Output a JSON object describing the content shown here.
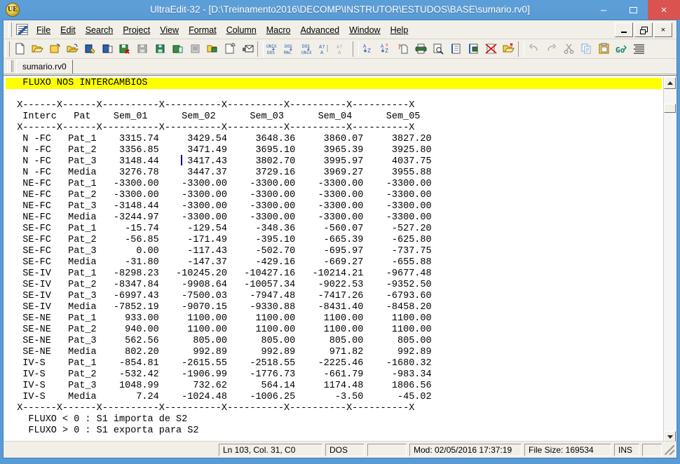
{
  "window": {
    "title": "UltraEdit-32 - [D:\\Treinamento2016\\DECOMP\\INSTRUTOR\\ESTUDOS\\BASE\\sumario.rv0]",
    "app_icon_text": "UE",
    "minimize_label": "–",
    "maximize_label": "",
    "close_label": "×"
  },
  "menu": {
    "items": [
      {
        "label": "File"
      },
      {
        "label": "Edit"
      },
      {
        "label": "Search"
      },
      {
        "label": "Project"
      },
      {
        "label": "View"
      },
      {
        "label": "Format"
      },
      {
        "label": "Column"
      },
      {
        "label": "Macro"
      },
      {
        "label": "Advanced"
      },
      {
        "label": "Window"
      },
      {
        "label": "Help"
      }
    ],
    "mdi_minimize": "_",
    "mdi_restore": "",
    "mdi_close": "×"
  },
  "toolbar": {
    "icons": [
      "new-file-icon",
      "open-file-icon",
      "close-file-icon",
      "open-all-icon",
      "save-as-icon",
      "save-icon",
      "save-close-icon",
      "save-all-icon",
      "make-copy-icon",
      "save-copy-icon",
      "revert-icon",
      "open-ftp-icon",
      "new-from-template-icon",
      "email-icon",
      "unix-to-dos-icon",
      "dos-to-mac-icon",
      "dos-to-unix-icon",
      "ascii-to-ansi-icon",
      "ansi-to-ascii-icon",
      "sort-ascending-icon",
      "sort-descending-icon",
      "spell-check-icon",
      "print-icon",
      "print-preview-icon",
      "page-setup-icon",
      "print-setup-icon",
      "delete-file-icon",
      "open-project-icon",
      "undo-icon",
      "redo-icon",
      "cut-icon",
      "copy-icon",
      "paste-icon",
      "goto-icon",
      "reindent-icon"
    ]
  },
  "tabs": {
    "items": [
      {
        "label": "sumario.rv0",
        "active": true
      }
    ]
  },
  "editor": {
    "highlight_line": "   FLUXO NOS INTERCAMBIOS",
    "highlight_color": "#ffff00",
    "caret_column": 31,
    "lines": [
      "  X------X------X----------X----------X----------X----------X----------X",
      "   Interc   Pat    Sem_01      Sem_02      Sem_03      Sem_04      Sem_05",
      "  X------X------X----------X----------X----------X----------X----------X",
      "   N -FC   Pat_1    3315.74     3429.54     3648.36     3860.07     3827.20",
      "   N -FC   Pat_2    3356.85     3471.49     3695.10     3965.39     3925.80",
      "   N -FC   Pat_3    3148.44     3417.43     3802.70     3995.97     4037.75",
      "   N -FC   Media    3276.78     3447.37     3729.16     3969.27     3955.88",
      "   NE-FC   Pat_1   -3300.00    -3300.00    -3300.00    -3300.00    -3300.00",
      "   NE-FC   Pat_2   -3300.00    -3300.00    -3300.00    -3300.00    -3300.00",
      "   NE-FC   Pat_3   -3148.44    -3300.00    -3300.00    -3300.00    -3300.00",
      "   NE-FC   Media   -3244.97    -3300.00    -3300.00    -3300.00    -3300.00",
      "   SE-FC   Pat_1     -15.74     -129.54     -348.36     -560.07     -527.20",
      "   SE-FC   Pat_2     -56.85     -171.49     -395.10     -665.39     -625.80",
      "   SE-FC   Pat_3       0.00     -117.43     -502.70     -695.97     -737.75",
      "   SE-FC   Media     -31.80     -147.37     -429.16     -669.27     -655.88",
      "   SE-IV   Pat_1   -8298.23   -10245.20   -10427.16   -10214.21    -9677.48",
      "   SE-IV   Pat_2   -8347.84    -9908.64   -10057.34    -9022.53    -9352.50",
      "   SE-IV   Pat_3   -6997.43    -7500.03    -7947.48    -7417.26    -6793.60",
      "   SE-IV   Media   -7852.19    -9070.15    -9330.88    -8431.40    -8458.20",
      "   SE-NE   Pat_1     933.00     1100.00     1100.00     1100.00     1100.00",
      "   SE-NE   Pat_2     940.00     1100.00     1100.00     1100.00     1100.00",
      "   SE-NE   Pat_3     562.56      805.00      805.00      805.00      805.00",
      "   SE-NE   Media     802.20      992.89      992.89      971.82      992.89",
      "   IV-S    Pat_1    -854.81    -2615.55    -2518.55    -2225.46    -1680.32",
      "   IV-S    Pat_2    -532.42    -1906.99    -1776.73     -661.79     -983.34",
      "   IV-S    Pat_3    1048.99      732.62      564.14     1174.48     1806.56",
      "   IV-S    Media       7.24    -1024.48    -1006.25       -3.50      -45.02",
      "  X------X------X----------X----------X----------X----------X----------X",
      "    FLUXO < 0 : S1 importa de S2",
      "    FLUXO > 0 : S1 exporta para S2"
    ]
  },
  "table_data": {
    "columns": [
      "Interc",
      "Pat",
      "Sem_01",
      "Sem_02",
      "Sem_03",
      "Sem_04",
      "Sem_05"
    ],
    "rows": [
      [
        "N -FC",
        "Pat_1",
        "3315.74",
        "3429.54",
        "3648.36",
        "3860.07",
        "3827.20"
      ],
      [
        "N -FC",
        "Pat_2",
        "3356.85",
        "3471.49",
        "3695.10",
        "3965.39",
        "3925.80"
      ],
      [
        "N -FC",
        "Pat_3",
        "3148.44",
        "3417.43",
        "3802.70",
        "3995.97",
        "4037.75"
      ],
      [
        "N -FC",
        "Media",
        "3276.78",
        "3447.37",
        "3729.16",
        "3969.27",
        "3955.88"
      ],
      [
        "NE-FC",
        "Pat_1",
        "-3300.00",
        "-3300.00",
        "-3300.00",
        "-3300.00",
        "-3300.00"
      ],
      [
        "NE-FC",
        "Pat_2",
        "-3300.00",
        "-3300.00",
        "-3300.00",
        "-3300.00",
        "-3300.00"
      ],
      [
        "NE-FC",
        "Pat_3",
        "-3148.44",
        "-3300.00",
        "-3300.00",
        "-3300.00",
        "-3300.00"
      ],
      [
        "NE-FC",
        "Media",
        "-3244.97",
        "-3300.00",
        "-3300.00",
        "-3300.00",
        "-3300.00"
      ],
      [
        "SE-FC",
        "Pat_1",
        "-15.74",
        "-129.54",
        "-348.36",
        "-560.07",
        "-527.20"
      ],
      [
        "SE-FC",
        "Pat_2",
        "-56.85",
        "-171.49",
        "-395.10",
        "-665.39",
        "-625.80"
      ],
      [
        "SE-FC",
        "Pat_3",
        "0.00",
        "-117.43",
        "-502.70",
        "-695.97",
        "-737.75"
      ],
      [
        "SE-FC",
        "Media",
        "-31.80",
        "-147.37",
        "-429.16",
        "-669.27",
        "-655.88"
      ],
      [
        "SE-IV",
        "Pat_1",
        "-8298.23",
        "-10245.20",
        "-10427.16",
        "-10214.21",
        "-9677.48"
      ],
      [
        "SE-IV",
        "Pat_2",
        "-8347.84",
        "-9908.64",
        "-10057.34",
        "-9022.53",
        "-9352.50"
      ],
      [
        "SE-IV",
        "Pat_3",
        "-6997.43",
        "-7500.03",
        "-7947.48",
        "-7417.26",
        "-6793.60"
      ],
      [
        "SE-IV",
        "Media",
        "-7852.19",
        "-9070.15",
        "-9330.88",
        "-8431.40",
        "-8458.20"
      ],
      [
        "SE-NE",
        "Pat_1",
        "933.00",
        "1100.00",
        "1100.00",
        "1100.00",
        "1100.00"
      ],
      [
        "SE-NE",
        "Pat_2",
        "940.00",
        "1100.00",
        "1100.00",
        "1100.00",
        "1100.00"
      ],
      [
        "SE-NE",
        "Pat_3",
        "562.56",
        "805.00",
        "805.00",
        "805.00",
        "805.00"
      ],
      [
        "SE-NE",
        "Media",
        "802.20",
        "992.89",
        "992.89",
        "971.82",
        "992.89"
      ],
      [
        "IV-S",
        "Pat_1",
        "-854.81",
        "-2615.55",
        "-2518.55",
        "-2225.46",
        "-1680.32"
      ],
      [
        "IV-S",
        "Pat_2",
        "-532.42",
        "-1906.99",
        "-1776.73",
        "-661.79",
        "-983.34"
      ],
      [
        "IV-S",
        "Pat_3",
        "1048.99",
        "732.62",
        "564.14",
        "1174.48",
        "1806.56"
      ],
      [
        "IV-S",
        "Media",
        "7.24",
        "-1024.48",
        "-1006.25",
        "-3.50",
        "-45.02"
      ]
    ],
    "title": "FLUXO NOS INTERCAMBIOS",
    "notes": [
      "FLUXO < 0 : S1 importa de S2",
      "FLUXO > 0 : S1 exporta para S2"
    ]
  },
  "statusbar": {
    "position": "Ln 103, Col. 31, C0",
    "line_ending": "DOS",
    "blank": "",
    "modified": "Mod: 02/05/2016 17:37:19",
    "file_size": "File Size: 169534",
    "insert_mode": "INS",
    "trailing": ""
  }
}
